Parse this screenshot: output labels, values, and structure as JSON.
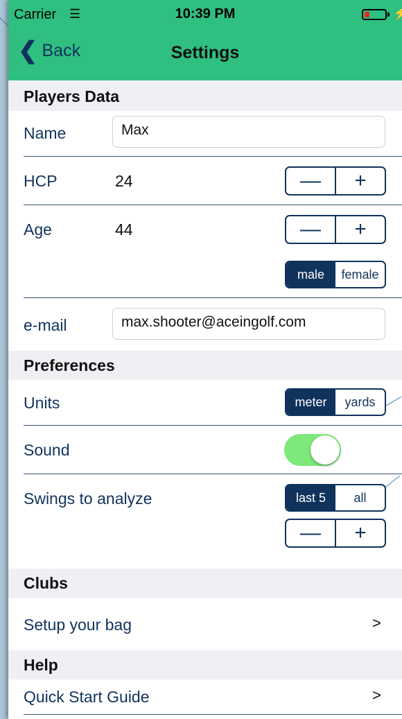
{
  "status_bar": {
    "carrier": "Carrier",
    "time": "10:39 PM"
  },
  "nav": {
    "back_label": "Back",
    "title": "Settings"
  },
  "players_data": {
    "header": "Players Data",
    "name_label": "Name",
    "name_value": "Max",
    "hcp_label": "HCP",
    "hcp_value": "24",
    "age_label": "Age",
    "age_value": "44",
    "gender_options": [
      "male",
      "female"
    ],
    "gender_selected": "male",
    "email_label": "e-mail",
    "email_value": "max.shooter@aceingolf.com"
  },
  "preferences": {
    "header": "Preferences",
    "units_label": "Units",
    "units_options": [
      "meter",
      "yards"
    ],
    "units_selected": "meter",
    "sound_label": "Sound",
    "sound_on": true,
    "swings_label": "Swings to analyze",
    "swings_options": [
      "last 5",
      "all"
    ],
    "swings_selected": "last 5"
  },
  "clubs": {
    "header": "Clubs",
    "setup_label": "Setup your bag",
    "setup_chevron": ">"
  },
  "help": {
    "header": "Help",
    "guide_label": "Quick Start Guide",
    "guide_chevron": ">"
  },
  "stepper": {
    "minus": "—",
    "plus": "+"
  },
  "colors": {
    "accent": "#2fbf80",
    "navy": "#10335c",
    "toggle_on": "#7ee87a"
  }
}
